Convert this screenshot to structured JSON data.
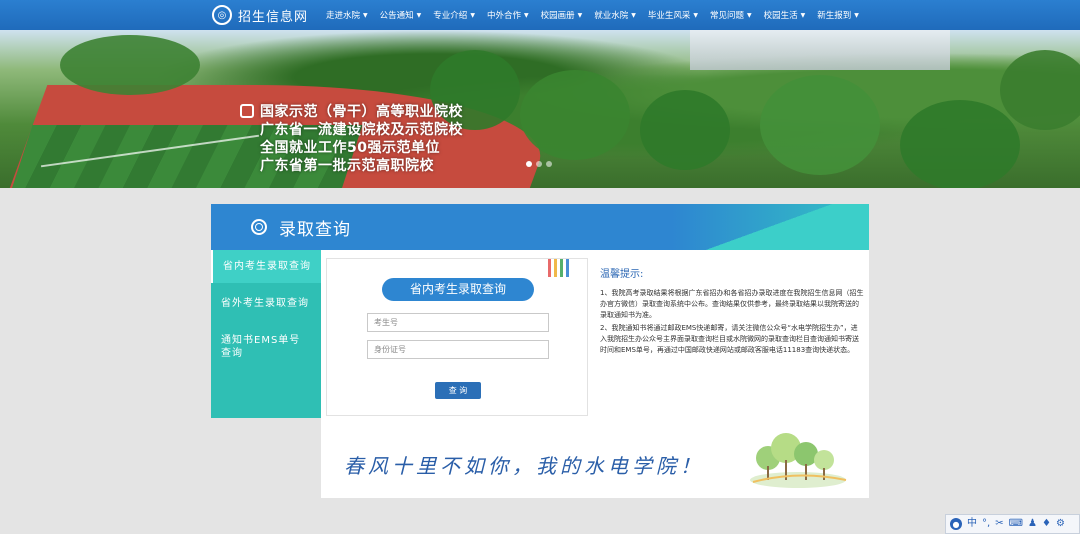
{
  "nav": {
    "logo_text": "招生信息网",
    "items": [
      {
        "label": "走进水院"
      },
      {
        "label": "公告通知"
      },
      {
        "label": "专业介绍"
      },
      {
        "label": "中外合作"
      },
      {
        "label": "校园画册"
      },
      {
        "label": "就业水院"
      },
      {
        "label": "毕业生风采"
      },
      {
        "label": "常见问题"
      },
      {
        "label": "校园生活"
      },
      {
        "label": "新生报到"
      }
    ]
  },
  "banner": {
    "slogans": [
      "国家示范（骨干）高等职业院校",
      "广东省一流建设院校及示范院校",
      "全国就业工作50强示范单位",
      "广东省第一批示范高职院校"
    ]
  },
  "section": {
    "title": "录取查询"
  },
  "sidebar": {
    "items": [
      {
        "label": "省内考生录取查询"
      },
      {
        "label": "省外考生录取查询"
      },
      {
        "label": "通知书EMS单号查询"
      }
    ]
  },
  "form": {
    "title": "省内考生录取查询",
    "exam_no_placeholder": "考生号",
    "id_no_placeholder": "身份证号",
    "submit_label": "查 询",
    "stripe_colors": [
      "#e86a6a",
      "#f0b84a",
      "#55b06c",
      "#4a8fd6"
    ]
  },
  "notice": {
    "title": "温馨提示:",
    "p1": "1、我院高考录取结果将根据广东省招办和各省招办录取进度在我院招生信息网（招生办官方微信）录取查询系统中公布。查询结果仅供参考，最终录取结果以我院寄送的录取通知书为准。",
    "p2": "2、我院通知书将通过邮政EMS快递邮寄，请关注微信公众号“水电学院招生办”，进入我院招生办公众号主界面录取查询栏目或水院微网的录取查询栏目查询通知书寄送时间和EMS单号，再通过中国邮政快递网站或邮政客服电话11183查询快递状态。"
  },
  "bottom_slogan": "春风十里不如你，我的水电学院！",
  "toolbar": {
    "lang": "中",
    "icons": [
      "user-icon",
      "dots-icon",
      "scissors-icon",
      "keyboard-icon",
      "person-icon",
      "shirt-icon",
      "gear-icon"
    ]
  }
}
